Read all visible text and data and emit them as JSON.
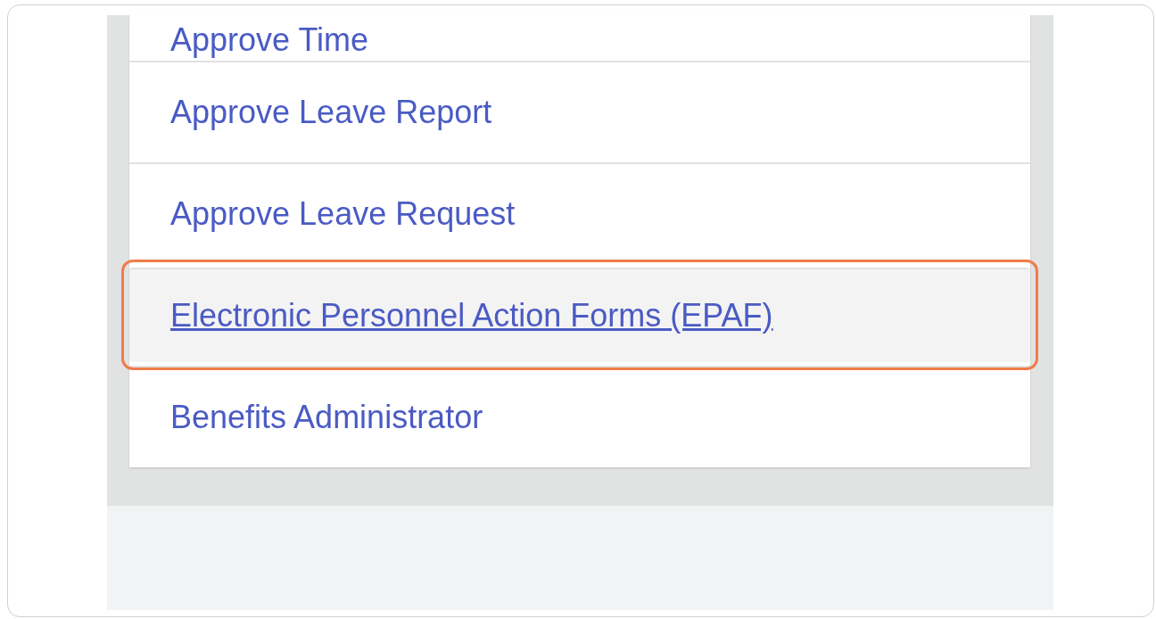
{
  "menu": {
    "items": [
      {
        "label": "Approve Time",
        "selected": false
      },
      {
        "label": "Approve Leave Report",
        "selected": false
      },
      {
        "label": "Approve Leave Request",
        "selected": false
      },
      {
        "label": "Electronic Personnel Action Forms (EPAF)",
        "selected": true
      },
      {
        "label": "Benefits Administrator",
        "selected": false
      }
    ]
  }
}
